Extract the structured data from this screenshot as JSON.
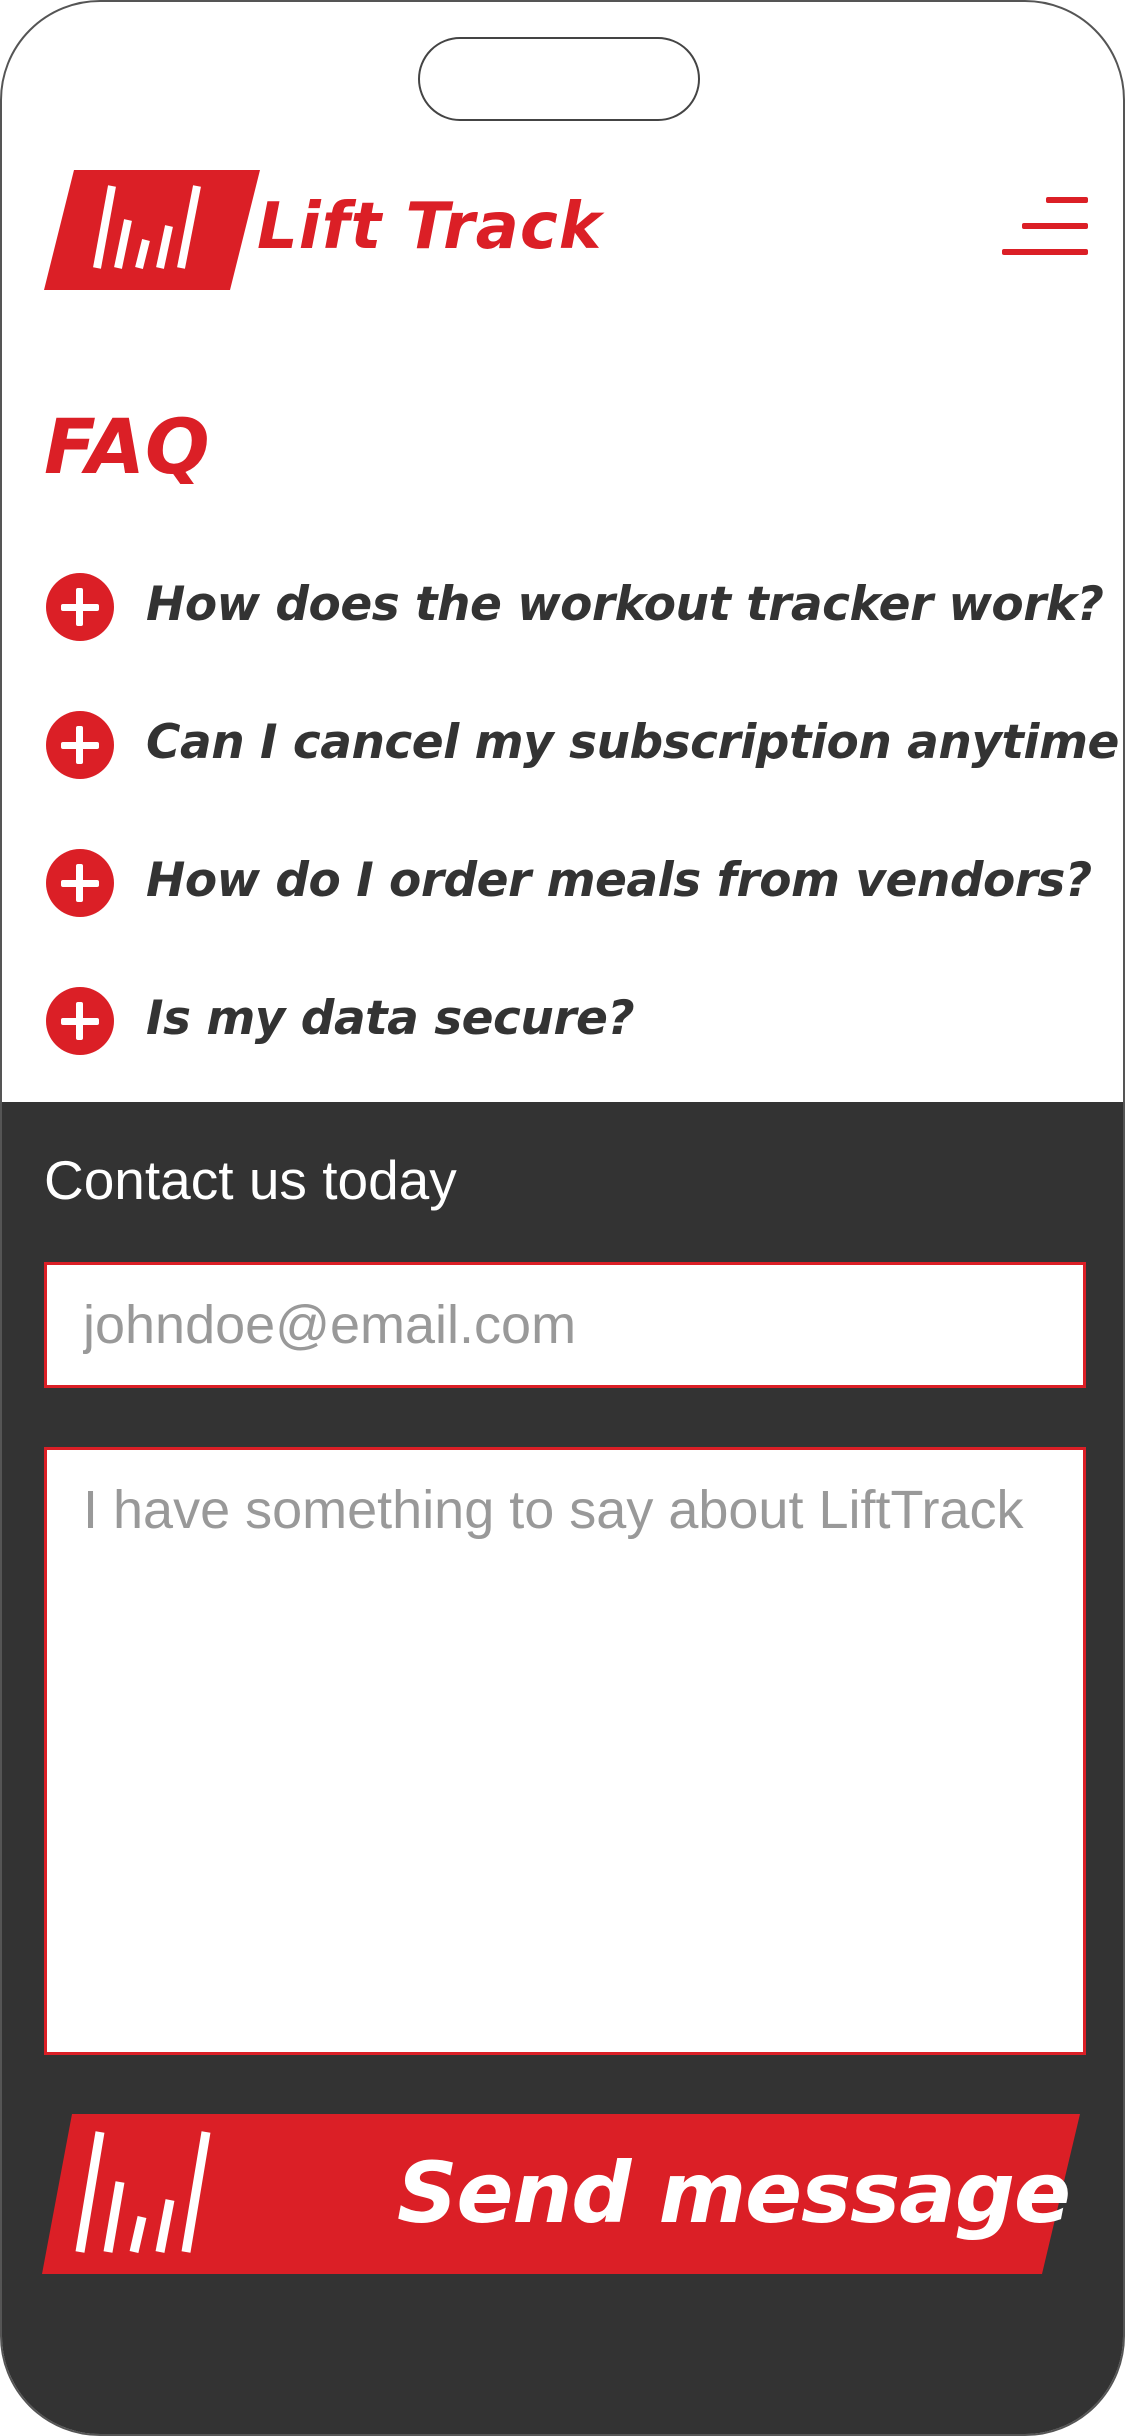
{
  "brand": {
    "name": "Lift Track",
    "color": "#db1f26"
  },
  "header": {
    "logo_icon": "bars-logo-icon",
    "menu_icon": "hamburger-menu-icon"
  },
  "faq": {
    "title": "FAQ",
    "items": [
      {
        "question": "How does the workout tracker work?",
        "icon": "plus-circle-icon"
      },
      {
        "question": "Can I cancel my subscription anytime?",
        "icon": "plus-circle-icon"
      },
      {
        "question": "How do I order meals from vendors?",
        "icon": "plus-circle-icon"
      },
      {
        "question": "Is my data secure?",
        "icon": "plus-circle-icon"
      }
    ]
  },
  "contact": {
    "title": "Contact us today",
    "email_placeholder": "johndoe@email.com",
    "message_placeholder": "I have something to say about LiftTrack",
    "send_label": "Send message",
    "background": "#333333"
  }
}
